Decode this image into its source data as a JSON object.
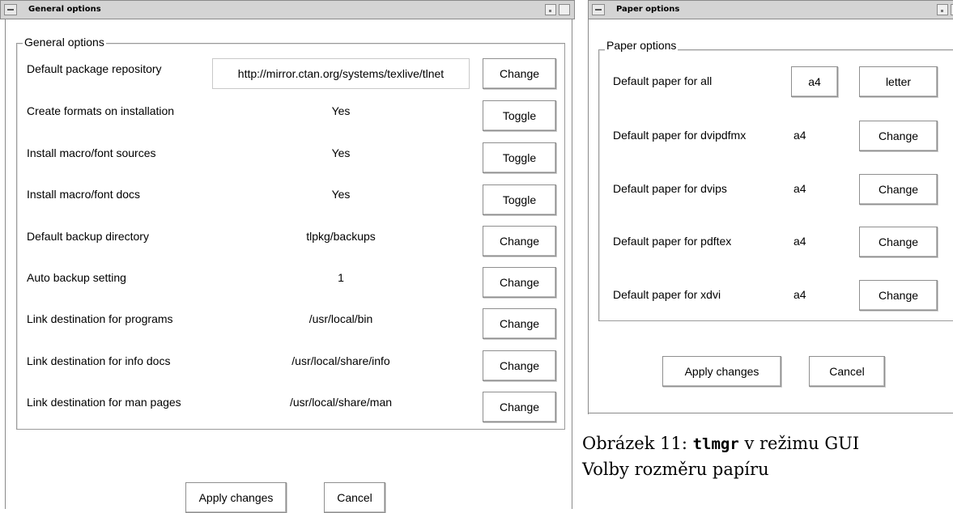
{
  "general_window": {
    "title": "General options",
    "group_label": "General options",
    "rows": [
      {
        "label": "Default package repository",
        "value": "http://mirror.ctan.org/systems/texlive/tlnet",
        "button": "Change",
        "editable": true
      },
      {
        "label": "Create formats on installation",
        "value": "Yes",
        "button": "Toggle"
      },
      {
        "label": "Install macro/font sources",
        "value": "Yes",
        "button": "Toggle"
      },
      {
        "label": "Install macro/font docs",
        "value": "Yes",
        "button": "Toggle"
      },
      {
        "label": "Default backup directory",
        "value": "tlpkg/backups",
        "button": "Change"
      },
      {
        "label": "Auto backup setting",
        "value": "1",
        "button": "Change"
      },
      {
        "label": "Link destination for programs",
        "value": "/usr/local/bin",
        "button": "Change"
      },
      {
        "label": "Link destination for info docs",
        "value": "/usr/local/share/info",
        "button": "Change"
      },
      {
        "label": "Link destination for man pages",
        "value": "/usr/local/share/man",
        "button": "Change"
      }
    ],
    "apply_label": "Apply changes",
    "cancel_label": "Cancel"
  },
  "paper_window": {
    "title": "Paper options",
    "group_label": "Paper options",
    "all_row": {
      "label": "Default paper for all",
      "option_a4": "a4",
      "option_letter": "letter"
    },
    "rows": [
      {
        "label": "Default paper for dvipdfmx",
        "value": "a4",
        "button": "Change"
      },
      {
        "label": "Default paper for dvips",
        "value": "a4",
        "button": "Change"
      },
      {
        "label": "Default paper for pdftex",
        "value": "a4",
        "button": "Change"
      },
      {
        "label": "Default paper for xdvi",
        "value": "a4",
        "button": "Change"
      }
    ],
    "apply_label": "Apply changes",
    "cancel_label": "Cancel"
  },
  "caption": {
    "prefix": "Obrázek 11: ",
    "command": "tlmgr",
    "suffix": " v režimu GUI",
    "line2": "Volby rozměru papíru"
  }
}
